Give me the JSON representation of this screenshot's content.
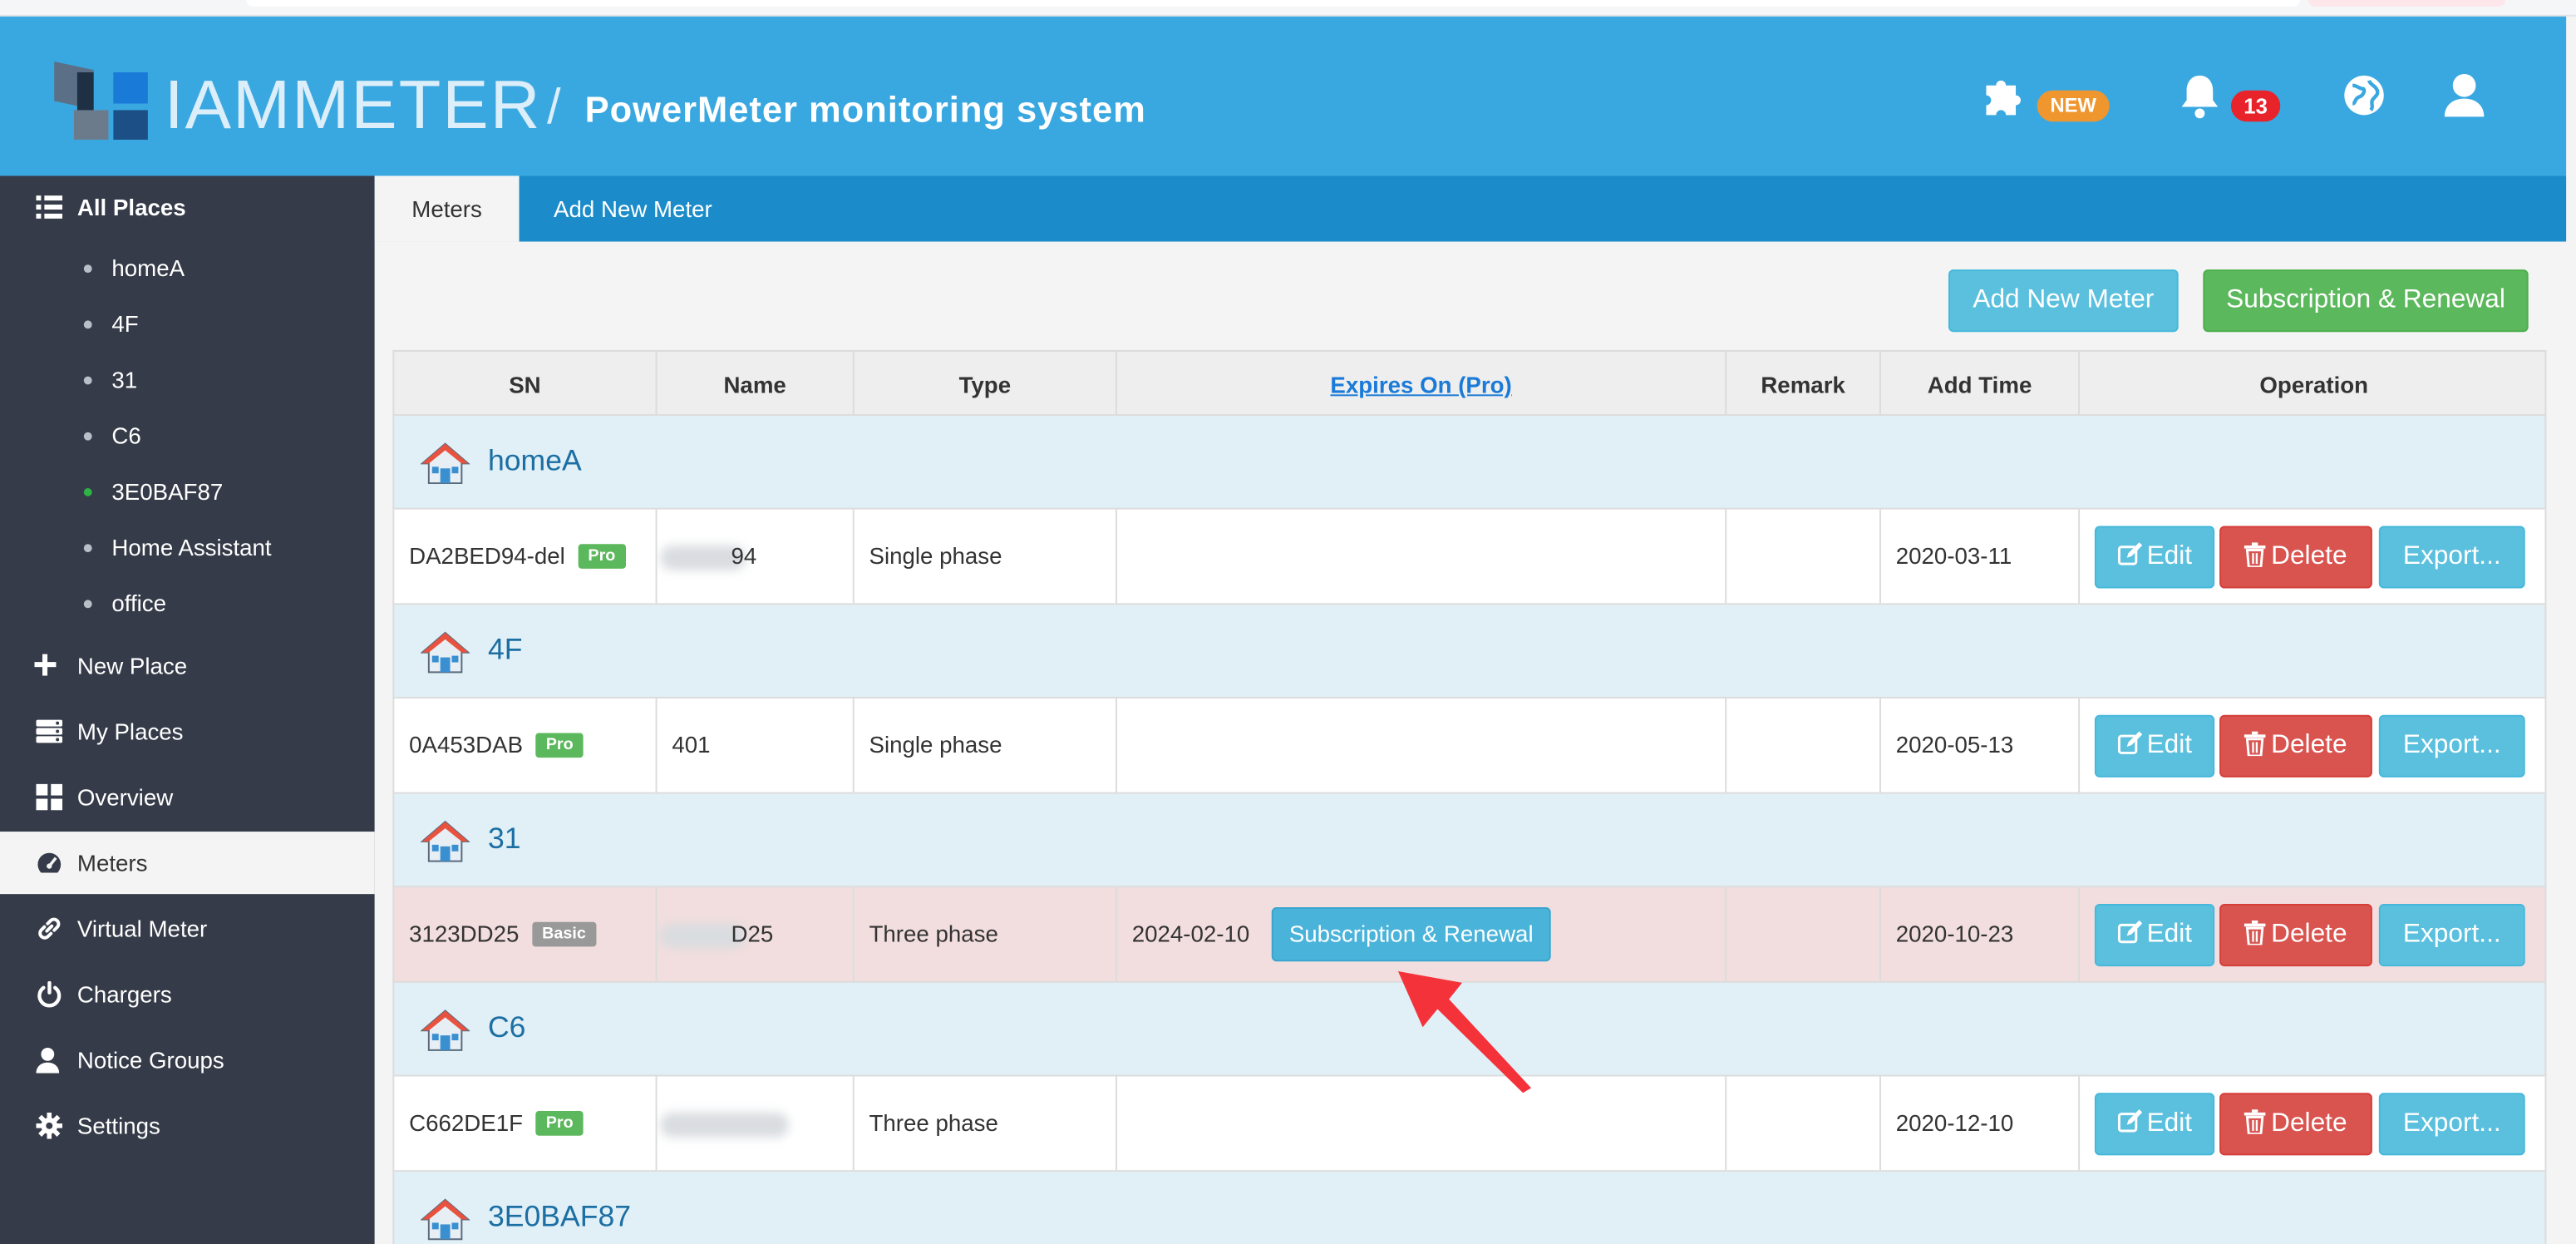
{
  "header": {
    "brand": "IAMMETER",
    "separator": "/",
    "system_title": "PowerMeter monitoring system",
    "new_badge": "NEW",
    "notification_count": "13",
    "colors": {
      "header": "#3aa8e0",
      "sidebar": "#353b48",
      "tabbar": "#1b8cc9"
    }
  },
  "sidebar": {
    "all_places": "All Places",
    "places": [
      {
        "label": "homeA",
        "online": false
      },
      {
        "label": "4F",
        "online": false
      },
      {
        "label": "31",
        "online": false
      },
      {
        "label": "C6",
        "online": false
      },
      {
        "label": "3E0BAF87",
        "online": true
      },
      {
        "label": "Home Assistant",
        "online": false
      },
      {
        "label": "office",
        "online": false
      }
    ],
    "nav": [
      {
        "label": "New Place",
        "icon": "plus-icon"
      },
      {
        "label": "My Places",
        "icon": "server-icon"
      },
      {
        "label": "Overview",
        "icon": "grid-icon"
      },
      {
        "label": "Meters",
        "icon": "dashboard-icon",
        "active": true
      },
      {
        "label": "Virtual Meter",
        "icon": "link-icon"
      },
      {
        "label": "Chargers",
        "icon": "power-icon"
      },
      {
        "label": "Notice Groups",
        "icon": "user-icon"
      },
      {
        "label": "Settings",
        "icon": "gear-icon"
      }
    ]
  },
  "tabs": [
    {
      "label": "Meters",
      "active": true
    },
    {
      "label": "Add New Meter",
      "active": false
    }
  ],
  "actions": {
    "add_new_meter": "Add New Meter",
    "subscription_renewal": "Subscription & Renewal"
  },
  "table": {
    "columns": [
      "SN",
      "Name",
      "Type",
      "Expires On (Pro)",
      "Remark",
      "Add Time",
      "Operation"
    ],
    "groups": [
      {
        "name": "homeA",
        "meter": {
          "sn": "DA2BED94-del",
          "plan": "Pro",
          "name": "94",
          "type": "Single phase",
          "expires": "",
          "remark": "",
          "add_time": "2020-03-11"
        }
      },
      {
        "name": "4F",
        "meter": {
          "sn": "0A453DAB",
          "plan": "Pro",
          "name": "401",
          "type": "Single phase",
          "expires": "",
          "remark": "",
          "add_time": "2020-05-13"
        }
      },
      {
        "name": "31",
        "meter": {
          "sn": "3123DD25",
          "plan": "Basic",
          "name": "D25",
          "type": "Three phase",
          "expires": "2024-02-10",
          "renew_label": "Subscription & Renewal",
          "remark": "",
          "add_time": "2020-10-23"
        }
      },
      {
        "name": "C6",
        "meter": {
          "sn": "C662DE1F",
          "plan": "Pro",
          "name": "",
          "type": "Three phase",
          "expires": "",
          "remark": "",
          "add_time": "2020-12-10"
        }
      },
      {
        "name": "3E0BAF87"
      }
    ],
    "ops": {
      "edit": "Edit",
      "delete": "Delete",
      "export": "Export..."
    }
  }
}
